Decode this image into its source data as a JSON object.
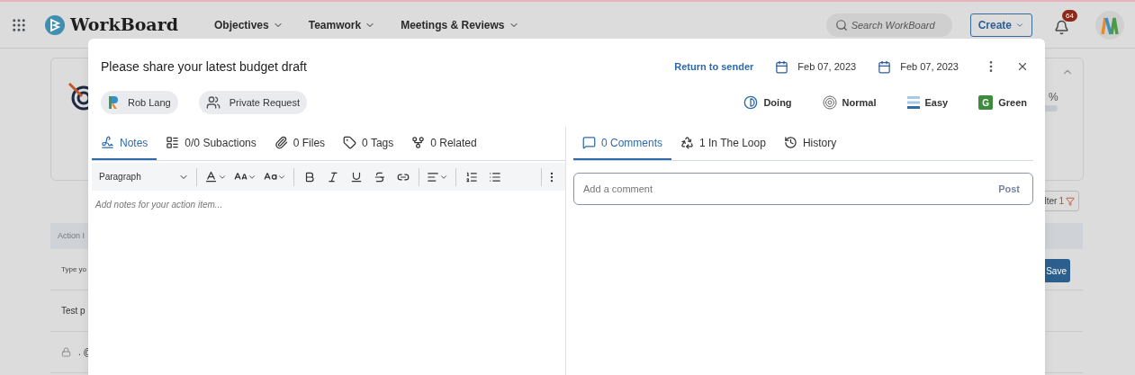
{
  "app": {
    "name": "WorkBoard",
    "nav": [
      {
        "label": "Objectives"
      },
      {
        "label": "Teamwork"
      },
      {
        "label": "Meetings & Reviews"
      }
    ],
    "search": {
      "placeholder": "Search WorkBoard"
    },
    "create": "Create",
    "notifications": "64"
  },
  "background": {
    "progress_text": "%",
    "progress": {
      "level": 0
    },
    "filter": "lter",
    "filter_count": "1",
    "table": {
      "header": "Action I",
      "rows": [
        {
          "kind": "input",
          "text": "Type yo",
          "button": "Save"
        },
        {
          "kind": "text",
          "text": "Test p"
        },
        {
          "kind": "locked",
          "text": ". @"
        }
      ]
    }
  },
  "dialog": {
    "title": "Please share your latest budget draft",
    "return": "Return to sender",
    "dates": [
      "Feb 07, 2023",
      "Feb 07, 2023"
    ],
    "chips": [
      {
        "kind": "person",
        "label": "Rob Lang"
      },
      {
        "kind": "privacy",
        "label": "Private Request"
      }
    ],
    "attributes": [
      {
        "kind": "status",
        "label": "Doing"
      },
      {
        "kind": "priority",
        "label": "Normal"
      },
      {
        "kind": "effort",
        "label": "Easy"
      },
      {
        "kind": "health",
        "label": "Green",
        "letter": "G"
      }
    ],
    "left_tabs": [
      {
        "kind": "notes",
        "label": "Notes",
        "selected": true
      },
      {
        "kind": "subactions",
        "label": "0/0 Subactions",
        "selected": false
      },
      {
        "kind": "files",
        "label": "0 Files",
        "selected": false
      },
      {
        "kind": "tags",
        "label": "0 Tags",
        "selected": false
      },
      {
        "kind": "related",
        "label": "0 Related",
        "selected": false
      }
    ],
    "toolbar": {
      "block_style": "Paragraph"
    },
    "notes_placeholder": "Add notes for your action item...",
    "right_tabs": [
      {
        "kind": "comments",
        "label": "0 Comments",
        "selected": true
      },
      {
        "kind": "loop",
        "label": "1 In The Loop",
        "selected": false
      },
      {
        "kind": "history",
        "label": "History",
        "selected": false
      }
    ],
    "comment": {
      "placeholder": "Add a comment",
      "post": "Post"
    }
  }
}
